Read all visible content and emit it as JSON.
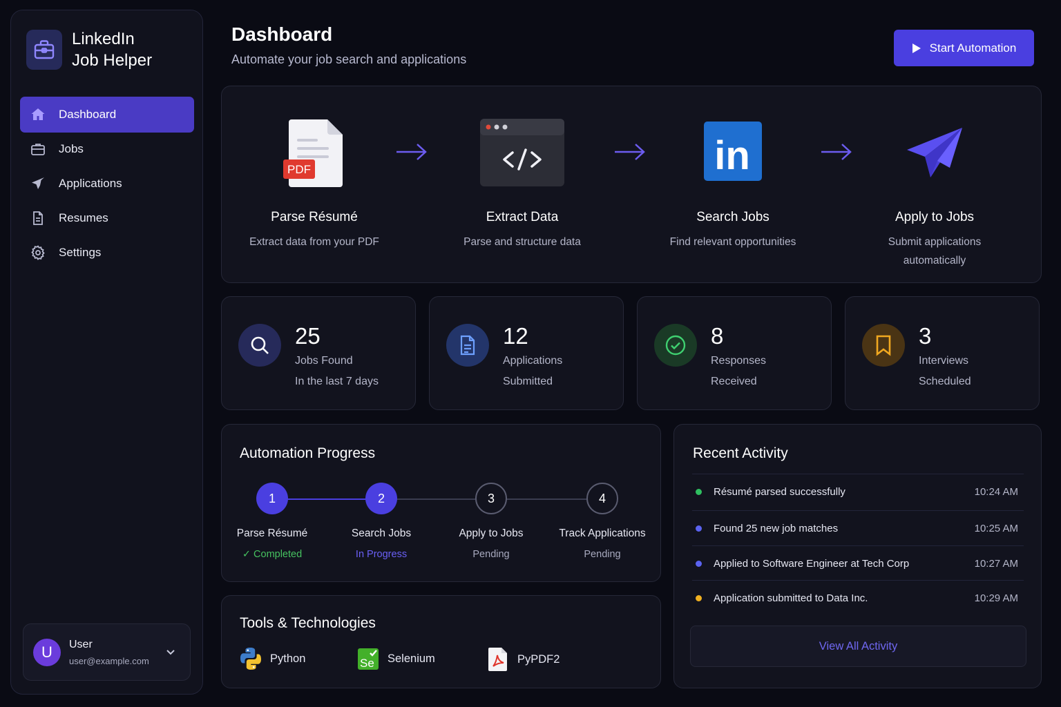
{
  "brand": {
    "line1": "LinkedIn",
    "line2": "Job Helper"
  },
  "nav": [
    {
      "label": "Dashboard",
      "icon": "home-icon",
      "active": true
    },
    {
      "label": "Jobs",
      "icon": "briefcase-icon"
    },
    {
      "label": "Applications",
      "icon": "paper-plane-icon"
    },
    {
      "label": "Resumes",
      "icon": "document-icon"
    },
    {
      "label": "Settings",
      "icon": "gear-icon"
    }
  ],
  "user": {
    "initial": "U",
    "name": "User",
    "email": "user@example.com"
  },
  "header": {
    "title": "Dashboard",
    "subtitle": "Automate your job search and applications",
    "start_label": "Start Automation"
  },
  "pipeline": [
    {
      "title": "Parse Résumé",
      "desc": "Extract data from your PDF",
      "icon": "pdf-file-icon",
      "badge": "PDF"
    },
    {
      "title": "Extract Data",
      "desc": "Parse and structure data",
      "icon": "code-window-icon"
    },
    {
      "title": "Search Jobs",
      "desc": "Find relevant opportunities",
      "icon": "linkedin-icon",
      "badge": "in"
    },
    {
      "title": "Apply to Jobs",
      "desc": "Submit applications automatically",
      "icon": "paper-plane-icon"
    }
  ],
  "stats": [
    {
      "value": "25",
      "line1": "Jobs Found",
      "line2": "In the last 7 days",
      "icon": "search-icon",
      "color": "#5b63f0"
    },
    {
      "value": "12",
      "line1": "Applications",
      "line2": "Submitted",
      "icon": "document-icon",
      "color": "#5b8cf5"
    },
    {
      "value": "8",
      "line1": "Responses",
      "line2": "Received",
      "icon": "check-circle-icon",
      "color": "#2fbf60"
    },
    {
      "value": "3",
      "line1": "Interviews",
      "line2": "Scheduled",
      "icon": "bookmark-icon",
      "color": "#f0a020"
    }
  ],
  "progress": {
    "title": "Automation Progress",
    "steps": [
      {
        "num": "1",
        "label": "Parse Résumé",
        "status": "Completed",
        "state": "done"
      },
      {
        "num": "2",
        "label": "Search Jobs",
        "status": "In Progress",
        "state": "active"
      },
      {
        "num": "3",
        "label": "Apply to Jobs",
        "status": "Pending",
        "state": "pending"
      },
      {
        "num": "4",
        "label": "Track Applications",
        "status": "Pending",
        "state": "pending"
      }
    ]
  },
  "tools": {
    "title": "Tools & Technologies",
    "items": [
      {
        "name": "Python",
        "icon": "python-icon"
      },
      {
        "name": "Selenium",
        "icon": "selenium-icon",
        "badge": "Se"
      },
      {
        "name": "PyPDF2",
        "icon": "pdf-icon"
      }
    ]
  },
  "activity": {
    "title": "Recent Activity",
    "items": [
      {
        "text": "Résumé parsed successfully",
        "time": "10:24 AM",
        "color": "#2fbf60"
      },
      {
        "text": "Found 25 new job matches",
        "time": "10:25 AM",
        "color": "#5b63f0"
      },
      {
        "text": "Applied to Software Engineer at Tech Corp",
        "time": "10:27 AM",
        "color": "#5b63f0"
      },
      {
        "text": "Application submitted to Data Inc.",
        "time": "10:29 AM",
        "color": "#f0b020"
      }
    ],
    "view_all": "View All Activity"
  }
}
